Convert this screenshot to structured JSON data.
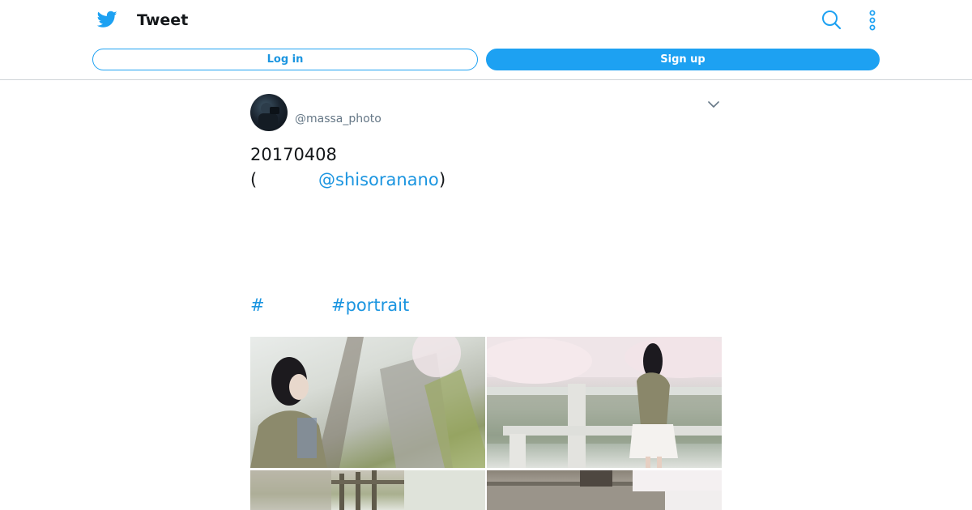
{
  "header": {
    "title": "Tweet",
    "login_label": "Log in",
    "signup_label": "Sign up",
    "logo_icon": "twitter-bird-icon",
    "search_icon": "search-icon",
    "more_icon": "more-vertical-icon"
  },
  "tweet": {
    "handle": "@massa_photo",
    "line1": "20170408",
    "line2_open": "(",
    "mention": "@shisoranano",
    "line2_close": ")",
    "hashtag1": "#",
    "hashtag2": "#portrait",
    "photos": [
      {
        "label": "photo-1"
      },
      {
        "label": "photo-2"
      },
      {
        "label": "photo-3"
      },
      {
        "label": "photo-4"
      }
    ]
  },
  "colors": {
    "accent": "#1da1f2",
    "link": "#1b95e0",
    "text": "#14171a",
    "secondary": "#657786",
    "divider": "#cfd4d8"
  }
}
